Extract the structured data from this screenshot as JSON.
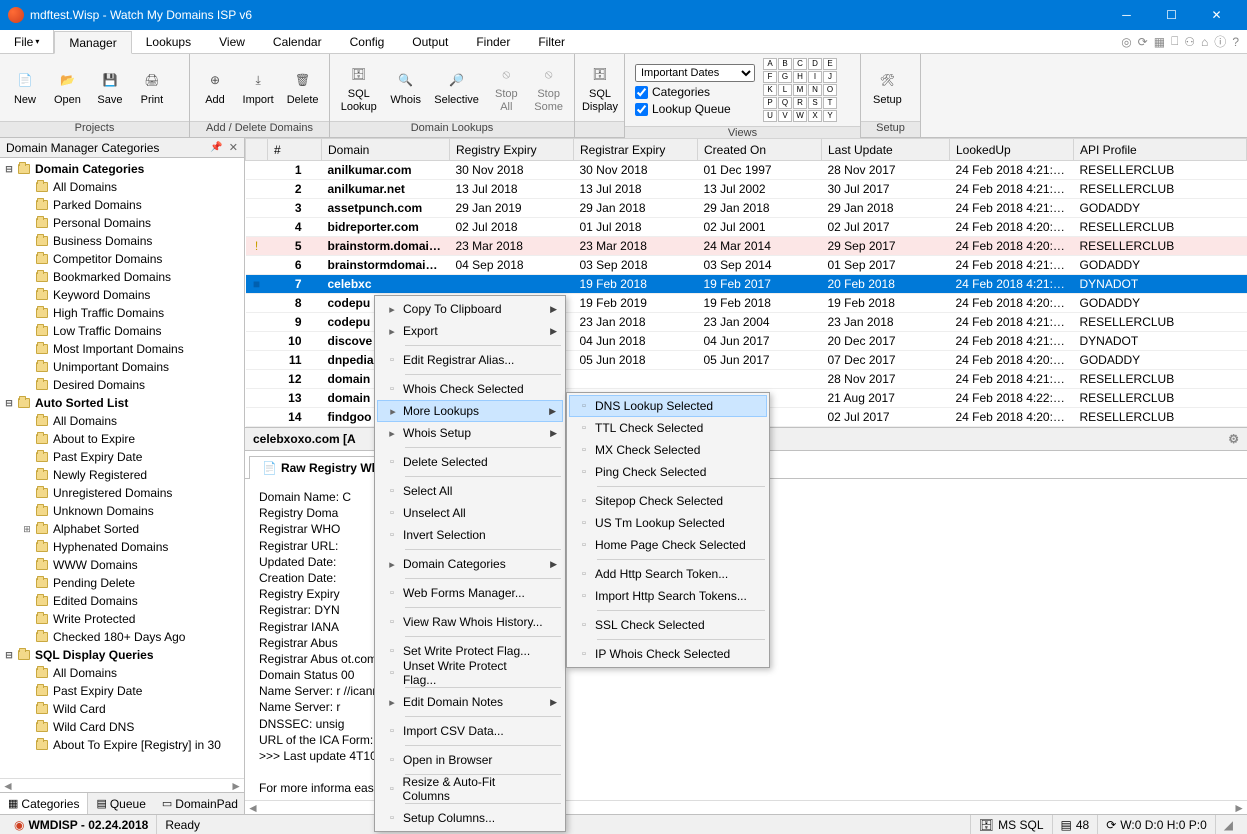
{
  "window": {
    "title": "mdftest.Wisp - Watch My Domains ISP v6"
  },
  "menu": {
    "file": "File",
    "tabs": [
      "Manager",
      "Lookups",
      "View",
      "Calendar",
      "Config",
      "Output",
      "Finder",
      "Filter"
    ],
    "active": 0
  },
  "ribbon": {
    "projects": {
      "new": "New",
      "open": "Open",
      "save": "Save",
      "print": "Print",
      "label": "Projects"
    },
    "addDelete": {
      "add": "Add",
      "import": "Import",
      "delete": "Delete",
      "label": "Add / Delete Domains"
    },
    "domainLookups": {
      "sql": "SQL\nLookup",
      "whois": "Whois",
      "selective": "Selective",
      "stopAll": "Stop\nAll",
      "stopSome": "Stop\nSome",
      "label": "Domain Lookups"
    },
    "sql": {
      "display": "SQL\nDisplay"
    },
    "views": {
      "dropdown": "Important Dates",
      "categories": "Categories",
      "lookupQueue": "Lookup Queue",
      "label": "Views",
      "letters": [
        "A",
        "B",
        "C",
        "D",
        "E",
        "F",
        "G",
        "H",
        "I",
        "J",
        "K",
        "L",
        "M",
        "N",
        "O",
        "P",
        "Q",
        "R",
        "S",
        "T",
        "U",
        "V",
        "W",
        "X",
        "Y"
      ]
    },
    "setup": {
      "btn": "Setup",
      "label": "Setup"
    }
  },
  "sidebar": {
    "title": "Domain Manager Categories",
    "roots": [
      {
        "label": "Domain Categories",
        "children": [
          "All Domains",
          "Parked Domains",
          "Personal Domains",
          "Business Domains",
          "Competitor Domains",
          "Bookmarked Domains",
          "Keyword Domains",
          "High Traffic Domains",
          "Low Traffic Domains",
          "Most Important Domains",
          "Unimportant Domains",
          "Desired Domains"
        ]
      },
      {
        "label": "Auto Sorted List",
        "children": [
          "All Domains",
          "About to Expire",
          "Past Expiry Date",
          "Newly Registered",
          "Unregistered Domains",
          "Unknown Domains",
          "Alphabet Sorted",
          "Hyphenated Domains",
          "WWW Domains",
          "Pending Delete",
          "Edited Domains",
          "Write Protected",
          "Checked 180+ Days Ago"
        ],
        "hasExpander": [
          6
        ]
      },
      {
        "label": "SQL Display Queries",
        "children": [
          "All Domains",
          "Past Expiry Date",
          "Wild Card",
          "Wild Card DNS",
          "About To Expire [Registry] in 30"
        ]
      }
    ],
    "tabs": {
      "categories": "Categories",
      "queue": "Queue",
      "domainPad": "DomainPad"
    }
  },
  "grid": {
    "cols": [
      "#",
      "Domain",
      "Registry Expiry",
      "Registrar Expiry",
      "Created On",
      "Last Update",
      "LookedUp",
      "API Profile"
    ],
    "rows": [
      {
        "n": "1",
        "d": "anilkumar.com",
        "re": "30 Nov 2018",
        "ra": "30 Nov 2018",
        "c": "01 Dec 1997",
        "lu": "28 Nov 2017",
        "lk": "24 Feb 2018 4:21:0…",
        "ap": "RESELLERCLUB"
      },
      {
        "n": "2",
        "d": "anilkumar.net",
        "re": "13 Jul 2018",
        "ra": "13 Jul 2018",
        "c": "13 Jul 2002",
        "lu": "30 Jul 2017",
        "lk": "24 Feb 2018 4:21:0…",
        "ap": "RESELLERCLUB"
      },
      {
        "n": "3",
        "d": "assetpunch.com",
        "re": "29 Jan 2019",
        "ra": "29 Jan 2018",
        "c": "29 Jan 2018",
        "lu": "29 Jan 2018",
        "lk": "24 Feb 2018 4:21:2…",
        "ap": "GODADDY"
      },
      {
        "n": "4",
        "d": "bidreporter.com",
        "re": "02 Jul 2018",
        "ra": "01 Jul 2018",
        "c": "02 Jul 2001",
        "lu": "02 Jul 2017",
        "lk": "24 Feb 2018 4:20:3…",
        "ap": "RESELLERCLUB"
      },
      {
        "n": "5",
        "d": "brainstorm.domai…",
        "re": "23 Mar 2018",
        "ra": "23 Mar 2018",
        "c": "24 Mar 2014",
        "lu": "29 Sep 2017",
        "lk": "24 Feb 2018 4:20:5…",
        "ap": "RESELLERCLUB",
        "warn": true,
        "flag": "!"
      },
      {
        "n": "6",
        "d": "brainstormdomain…",
        "re": "04 Sep 2018",
        "ra": "03 Sep 2018",
        "c": "03 Sep 2014",
        "lu": "01 Sep 2017",
        "lk": "24 Feb 2018 4:21:3…",
        "ap": "GODADDY"
      },
      {
        "n": "7",
        "d": "celebxc",
        "re": "",
        "ra": "19 Feb 2018",
        "c": "19 Feb 2017",
        "lu": "20 Feb 2018",
        "lk": "24 Feb 2018 4:21:1…",
        "ap": "DYNADOT",
        "sel": true,
        "flag": "■"
      },
      {
        "n": "8",
        "d": "codepu",
        "re": "",
        "ra": "19 Feb 2019",
        "c": "19 Feb 2018",
        "lu": "19 Feb 2018",
        "lk": "24 Feb 2018 4:20:5…",
        "ap": "GODADDY"
      },
      {
        "n": "9",
        "d": "codepu",
        "re": "",
        "ra": "23 Jan 2018",
        "c": "23 Jan 2004",
        "lu": "23 Jan 2018",
        "lk": "24 Feb 2018 4:21:2…",
        "ap": "RESELLERCLUB"
      },
      {
        "n": "10",
        "d": "discove",
        "re": "",
        "ra": "04 Jun 2018",
        "c": "04 Jun 2017",
        "lu": "20 Dec 2017",
        "lk": "24 Feb 2018 4:21:2…",
        "ap": "DYNADOT"
      },
      {
        "n": "11",
        "d": "dnpedia",
        "re": "",
        "ra": "05 Jun 2018",
        "c": "05 Jun 2017",
        "lu": "07 Dec 2017",
        "lk": "24 Feb 2018 4:20:5…",
        "ap": "GODADDY"
      },
      {
        "n": "12",
        "d": "domain",
        "re": "",
        "ra": "",
        "c": "",
        "lu": "28 Nov 2017",
        "lk": "24 Feb 2018 4:21:5…",
        "ap": "RESELLERCLUB"
      },
      {
        "n": "13",
        "d": "domain",
        "re": "",
        "ra": "",
        "c": "",
        "lu": "21 Aug 2017",
        "lk": "24 Feb 2018 4:22:1…",
        "ap": "RESELLERCLUB"
      },
      {
        "n": "14",
        "d": "findgoo",
        "re": "",
        "ra": "",
        "c": "",
        "lu": "02 Jul 2017",
        "lk": "24 Feb 2018 4:20:0…",
        "ap": "RESELLERCLUB"
      }
    ]
  },
  "detail": {
    "header": "celebxoxo.com [A",
    "tabs": {
      "rawWhois": "Raw Registry Wh",
      "custom": "Custom Data"
    },
    "body": "Domain Name: C\nRegistry Doma\nRegistrar WHO\nRegistrar URL:\nUpdated Date:\nCreation Date:\nRegistry Expiry\nRegistrar: DYN\nRegistrar IANA\nRegistrar Abus\nRegistrar Abus                                          ot.com\nDomain Status                                          00\nName Server: r                    //icann.org/epp#clientTransferProhibited\nName Server: r\nDNSSEC: unsig\nURL of the ICA                                Form: https://www.icann.org/wicf/\n>>> Last update                               4T10:50:33Z <<<\n\nFor more informa                                  ease visit https://icann.org/epp"
  },
  "context1": {
    "items": [
      {
        "t": "Copy To Clipboard",
        "sub": true
      },
      {
        "t": "Export",
        "sub": true,
        "sep": true
      },
      {
        "t": "Edit Registrar Alias...",
        "sep": true
      },
      {
        "t": "Whois Check Selected"
      },
      {
        "t": "More Lookups",
        "sub": true,
        "hover": true
      },
      {
        "t": "Whois Setup",
        "sub": true,
        "sep": true
      },
      {
        "t": "Delete Selected",
        "sep": true
      },
      {
        "t": "Select All"
      },
      {
        "t": "Unselect All"
      },
      {
        "t": "Invert Selection",
        "sep": true
      },
      {
        "t": "Domain Categories",
        "sub": true,
        "sep": true
      },
      {
        "t": "Web Forms Manager...",
        "sep": true
      },
      {
        "t": "View Raw Whois History...",
        "sep": true
      },
      {
        "t": "Set Write Protect Flag..."
      },
      {
        "t": "Unset Write Protect Flag...",
        "sep": true
      },
      {
        "t": "Edit Domain Notes",
        "sub": true,
        "sep": true
      },
      {
        "t": "Import CSV Data...",
        "sep": true
      },
      {
        "t": "Open in Browser",
        "sep": true
      },
      {
        "t": "Resize & Auto-Fit Columns",
        "sep": true
      },
      {
        "t": "Setup Columns..."
      }
    ]
  },
  "context2": {
    "items": [
      {
        "t": "DNS Lookup Selected",
        "hover": true
      },
      {
        "t": "TTL Check Selected"
      },
      {
        "t": "MX Check Selected"
      },
      {
        "t": "Ping Check Selected",
        "sep": true
      },
      {
        "t": "Sitepop Check Selected"
      },
      {
        "t": "US Tm Lookup Selected"
      },
      {
        "t": "Home Page Check Selected",
        "sep": true
      },
      {
        "t": "Add Http Search Token..."
      },
      {
        "t": "Import Http Search Tokens...",
        "sep": true
      },
      {
        "t": "SSL Check Selected",
        "sep": true
      },
      {
        "t": "IP Whois Check Selected"
      }
    ]
  },
  "status": {
    "app": "WMDISP - 02.24.2018",
    "ready": "Ready",
    "db": "MS SQL",
    "count": "48",
    "wdhp": "W:0 D:0 H:0 P:0"
  }
}
